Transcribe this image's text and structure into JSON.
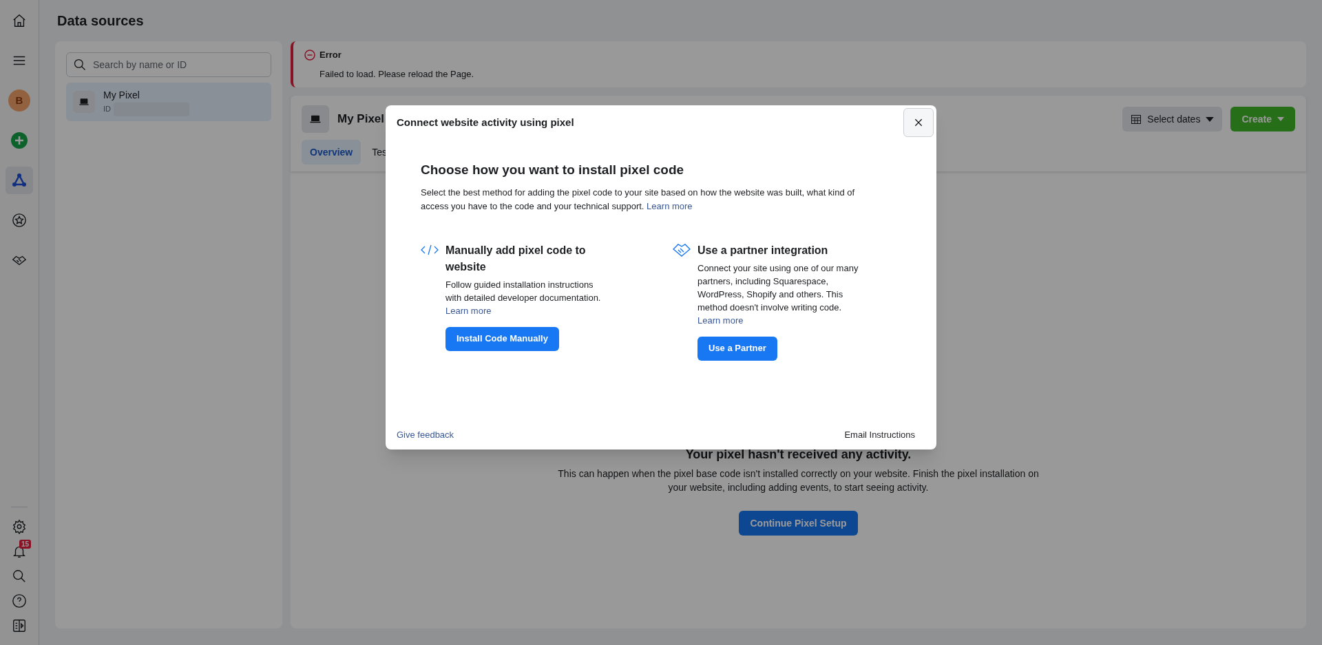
{
  "rail": {
    "avatar": "B",
    "top_items": [
      {
        "kind": "home",
        "selected": false
      },
      {
        "kind": "menu",
        "selected": false
      },
      {
        "kind": "avatar",
        "selected": false
      },
      {
        "kind": "create",
        "selected": false
      },
      {
        "kind": "data_sources",
        "selected": true
      },
      {
        "kind": "star",
        "selected": false
      },
      {
        "kind": "partners",
        "selected": false
      }
    ],
    "bottom_items": [
      {
        "kind": "settings"
      },
      {
        "kind": "notifications",
        "badge": "15"
      },
      {
        "kind": "search"
      },
      {
        "kind": "help"
      },
      {
        "kind": "panel"
      }
    ]
  },
  "page_title": "Data sources",
  "sources": {
    "search": {
      "placeholder": "Search by name or ID"
    },
    "items": [
      {
        "name": "My Pixel",
        "id_label": "ID",
        "selected": true
      }
    ]
  },
  "error": {
    "title": "Error",
    "message": "Failed to load. Please reload the Page."
  },
  "pixel": {
    "name": "My Pixel",
    "select_dates": "Select dates",
    "create": "Create",
    "tabs": [
      {
        "label": "Overview",
        "selected": true
      },
      {
        "label": "Tes",
        "selected": false
      }
    ],
    "empty": {
      "title": "Your pixel hasn't received any activity.",
      "text": "This can happen when the pixel base code isn't installed correctly on your website. Finish the pixel installation on your website, including adding events, to start seeing activity.",
      "button": "Continue Pixel Setup"
    }
  },
  "modal": {
    "title": "Connect website activity using pixel",
    "heading": "Choose how you want to install pixel code",
    "intro": "Select the best method for adding the pixel code to your site based on how the website was built, what kind of access you have to the code and your technical support.",
    "intro_link": "Learn more",
    "options": [
      {
        "kind": "manual",
        "title": "Manually add pixel code to website",
        "text": "Follow guided installation instructions with detailed developer documentation.",
        "link": "Learn more",
        "button": "Install Code Manually"
      },
      {
        "kind": "partner",
        "title": "Use a partner integration",
        "text": "Connect your site using one of our many partners, including Squarespace, WordPress, Shopify and others. This method doesn't involve writing code.",
        "link": "Learn more",
        "button": "Use a Partner"
      }
    ],
    "feedback": "Give feedback",
    "email": "Email Instructions"
  }
}
